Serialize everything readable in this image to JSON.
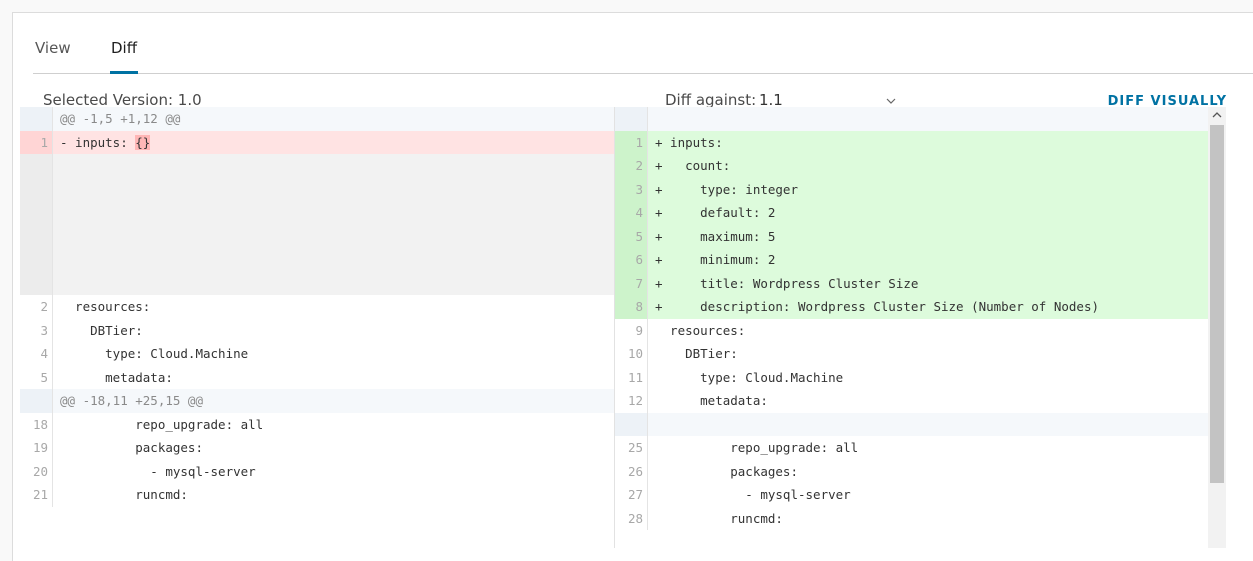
{
  "tabs": [
    {
      "label": "View",
      "active": false
    },
    {
      "label": "Diff",
      "active": true
    }
  ],
  "header": {
    "selected_version": "Selected Version: 1.0",
    "diff_against_label": "Diff against:",
    "diff_against_value": "1.1",
    "diff_visually": "DIFF VISUALLY"
  },
  "colors": {
    "accent": "#0072a3",
    "deleted_bg": "#ffe3e3",
    "added_bg": "#ddfbdc"
  },
  "icons": {
    "select_chevron": "chevron-down-icon",
    "scroll_up": "chevron-up-icon"
  },
  "diff": {
    "left": [
      {
        "type": "hunk",
        "ln": "",
        "code": "@@ -1,5 +1,12 @@"
      },
      {
        "type": "del",
        "ln": "1",
        "code": "- inputs: ",
        "hl": "{}"
      },
      {
        "type": "empty",
        "ln": "",
        "code": ""
      },
      {
        "type": "empty",
        "ln": "",
        "code": ""
      },
      {
        "type": "empty",
        "ln": "",
        "code": ""
      },
      {
        "type": "empty",
        "ln": "",
        "code": ""
      },
      {
        "type": "empty",
        "ln": "",
        "code": ""
      },
      {
        "type": "empty",
        "ln": "",
        "code": ""
      },
      {
        "type": "ctx",
        "ln": "2",
        "code": "  resources:"
      },
      {
        "type": "ctx",
        "ln": "3",
        "code": "    DBTier:"
      },
      {
        "type": "ctx",
        "ln": "4",
        "code": "      type: Cloud.Machine"
      },
      {
        "type": "ctx",
        "ln": "5",
        "code": "      metadata:"
      },
      {
        "type": "hunk",
        "ln": "",
        "code": "@@ -18,11 +25,15 @@"
      },
      {
        "type": "ctx",
        "ln": "18",
        "code": "          repo_upgrade: all"
      },
      {
        "type": "ctx",
        "ln": "19",
        "code": "          packages:"
      },
      {
        "type": "ctx",
        "ln": "20",
        "code": "            - mysql-server"
      },
      {
        "type": "ctx",
        "ln": "21",
        "code": "          runcmd:"
      }
    ],
    "right": [
      {
        "type": "hunk",
        "ln": "",
        "code": ""
      },
      {
        "type": "add",
        "ln": "1",
        "code": "+ inputs:"
      },
      {
        "type": "add",
        "ln": "2",
        "code": "+   count:"
      },
      {
        "type": "add",
        "ln": "3",
        "code": "+     type: integer"
      },
      {
        "type": "add",
        "ln": "4",
        "code": "+     default: 2"
      },
      {
        "type": "add",
        "ln": "5",
        "code": "+     maximum: 5"
      },
      {
        "type": "add",
        "ln": "6",
        "code": "+     minimum: 2"
      },
      {
        "type": "add",
        "ln": "7",
        "code": "+     title: Wordpress Cluster Size"
      },
      {
        "type": "add",
        "ln": "8",
        "code": "+     description: Wordpress Cluster Size (Number of Nodes)"
      },
      {
        "type": "ctx",
        "ln": "9",
        "code": "  resources:"
      },
      {
        "type": "ctx",
        "ln": "10",
        "code": "    DBTier:"
      },
      {
        "type": "ctx",
        "ln": "11",
        "code": "      type: Cloud.Machine"
      },
      {
        "type": "ctx",
        "ln": "12",
        "code": "      metadata:"
      },
      {
        "type": "hunk",
        "ln": "",
        "code": ""
      },
      {
        "type": "ctx",
        "ln": "25",
        "code": "          repo_upgrade: all"
      },
      {
        "type": "ctx",
        "ln": "26",
        "code": "          packages:"
      },
      {
        "type": "ctx",
        "ln": "27",
        "code": "            - mysql-server"
      },
      {
        "type": "ctx",
        "ln": "28",
        "code": "          runcmd:"
      }
    ]
  }
}
